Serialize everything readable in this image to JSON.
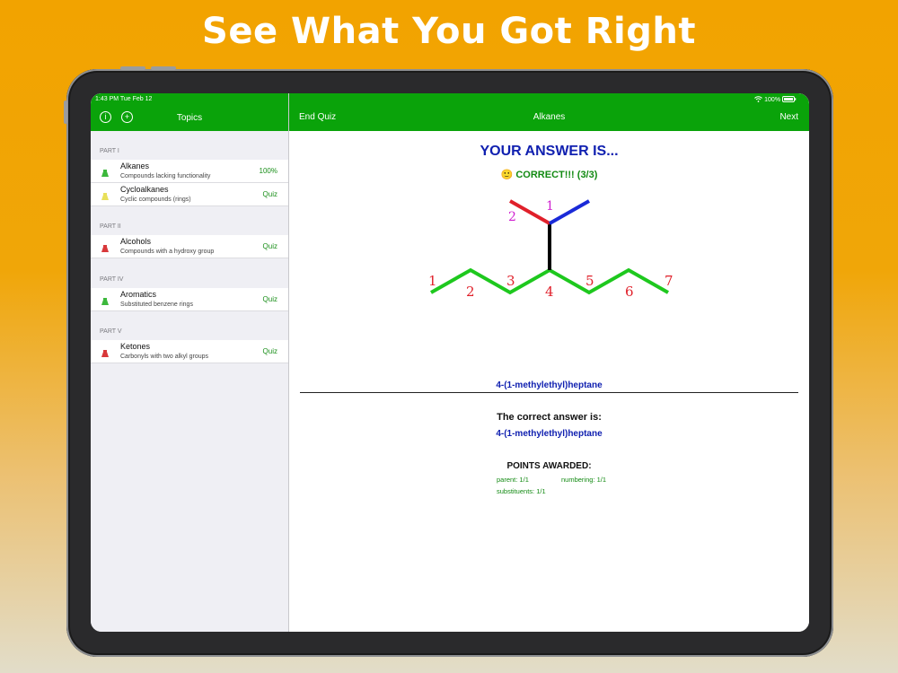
{
  "headline": "See What You Got Right",
  "status_bar": {
    "time_date": "1:43 PM   Tue Feb 12",
    "battery": "100%"
  },
  "sidebar": {
    "title": "Topics",
    "info_icon": "i",
    "add_icon": "+",
    "sections": [
      {
        "label": "PART I"
      },
      {
        "label": "PART II"
      },
      {
        "label": "PART IV"
      },
      {
        "label": "PART V"
      }
    ],
    "topics": [
      {
        "title": "Alkanes",
        "subtitle": "Compounds lacking functionality",
        "status": "100%",
        "flask_color": "#3cb83c"
      },
      {
        "title": "Cycloalkanes",
        "subtitle": "Cyclic compounds (rings)",
        "status": "Quiz",
        "flask_color": "#e8e05a"
      },
      {
        "title": "Alcohols",
        "subtitle": "Compounds with a hydroxy group",
        "status": "Quiz",
        "flask_color": "#d8383a"
      },
      {
        "title": "Aromatics",
        "subtitle": "Substituted benzene rings",
        "status": "Quiz",
        "flask_color": "#3cb83c"
      },
      {
        "title": "Ketones",
        "subtitle": "Carbonyls with two alkyl groups",
        "status": "Quiz",
        "flask_color": "#d8383a"
      }
    ]
  },
  "main": {
    "end_quiz": "End Quiz",
    "title": "Alkanes",
    "next": "Next",
    "answer_title": "YOUR ANSWER IS...",
    "correct_text": "🙂 CORRECT!!! (3/3)",
    "molecule": {
      "chain_color": "#1ec81e",
      "branch_stem_color": "#000000",
      "branch_left_color": "#e0202a",
      "branch_right_color": "#1a2ad8",
      "chain_numbers": [
        "1",
        "2",
        "3",
        "4",
        "5",
        "6",
        "7"
      ],
      "branch_numbers": [
        "1",
        "2"
      ]
    },
    "given_name": "4-(1-methylethyl)heptane",
    "correct_label": "The correct answer is:",
    "correct_name": "4-(1-methylethyl)heptane",
    "points_title": "POINTS AWARDED:",
    "points": [
      {
        "label": "parent: 1/1"
      },
      {
        "label": "numbering: 1/1"
      },
      {
        "label": "substituents: 1/1"
      }
    ]
  }
}
